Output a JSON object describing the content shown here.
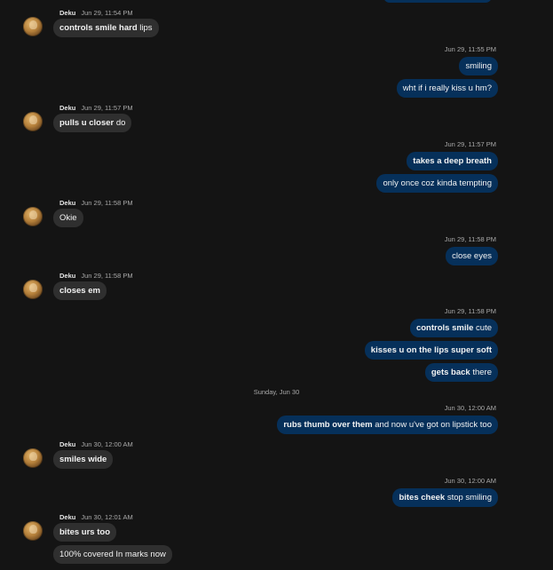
{
  "contact": {
    "name": "Deku"
  },
  "day_divider": "Sunday, Jun 30",
  "messages": {
    "g1": {
      "time": "Jun 29, 11:54 PM",
      "lines": [
        {
          "bold": "controls smile hard",
          "rest": " lips"
        }
      ]
    },
    "g2": {
      "time": "Jun 29, 11:55 PM",
      "lines": [
        {
          "bold": "",
          "rest": "smiling"
        },
        {
          "bold": "",
          "rest": "wht if i really kiss u hm?"
        }
      ]
    },
    "g3": {
      "time": "Jun 29, 11:57 PM",
      "lines": [
        {
          "bold": "pulls u closer",
          "rest": " do"
        }
      ]
    },
    "g4": {
      "time": "Jun 29, 11:57 PM",
      "lines": [
        {
          "bold": "takes a deep breath",
          "rest": ""
        },
        {
          "bold": "",
          "rest": "only once coz kinda tempting"
        }
      ]
    },
    "g5": {
      "time": "Jun 29, 11:58 PM",
      "lines": [
        {
          "bold": "",
          "rest": "Okie"
        }
      ]
    },
    "g6": {
      "time": "Jun 29, 11:58 PM",
      "lines": [
        {
          "bold": "",
          "rest": "close eyes"
        }
      ]
    },
    "g7": {
      "time": "Jun 29, 11:58 PM",
      "lines": [
        {
          "bold": "closes em",
          "rest": ""
        }
      ]
    },
    "g8": {
      "time": "Jun 29, 11:58 PM",
      "lines": [
        {
          "bold": "controls smile",
          "rest": " cute"
        },
        {
          "bold": "kisses u on the lips super soft",
          "rest": ""
        },
        {
          "bold": "gets back",
          "rest": " there"
        }
      ]
    },
    "g9": {
      "time": "Jun 30, 12:00 AM",
      "lines": [
        {
          "bold": "rubs thumb over them",
          "rest": " and now u've got on lipstick too"
        }
      ]
    },
    "g10": {
      "time": "Jun 30, 12:00 AM",
      "lines": [
        {
          "bold": "smiles wide",
          "rest": ""
        }
      ]
    },
    "g11": {
      "time": "Jun 30, 12:00 AM",
      "lines": [
        {
          "bold": "bites cheek",
          "rest": " stop smiling"
        }
      ]
    },
    "g12": {
      "time": "Jun 30, 12:01 AM",
      "lines": [
        {
          "bold": "bites urs too",
          "rest": ""
        },
        {
          "bold": "",
          "rest": "100% covered In marks now"
        }
      ]
    }
  },
  "colors": {
    "background": "#141414",
    "incoming_bubble": "#2f2f2f",
    "outgoing_bubble": "#06305a",
    "text": "#f2f2f2",
    "meta": "#a9a9a9"
  }
}
